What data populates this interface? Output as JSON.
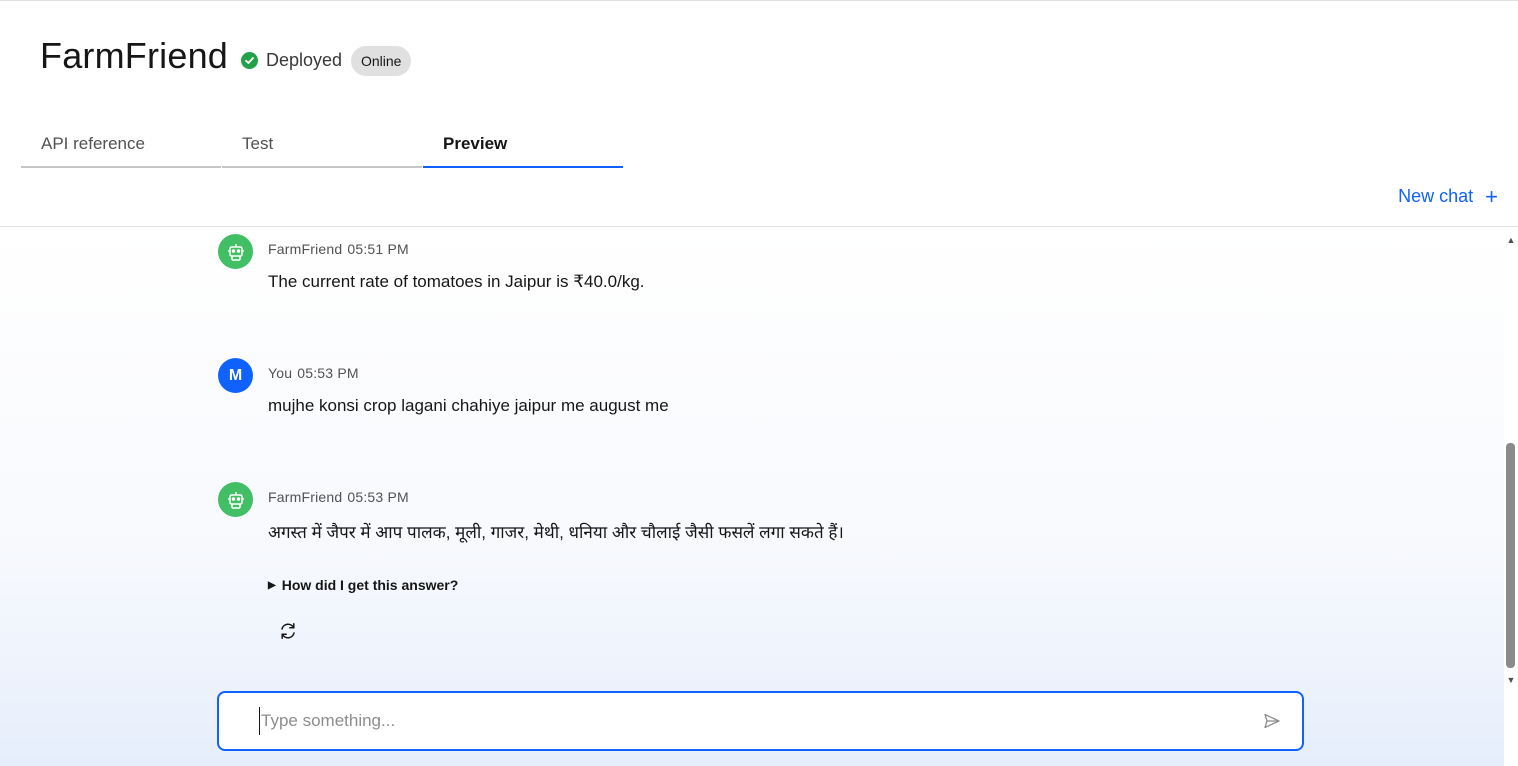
{
  "header": {
    "app_title": "FarmFriend",
    "status_text": "Deployed",
    "badge": "Online",
    "status_color": "#24a148"
  },
  "tabs": [
    {
      "label": "API reference",
      "active": false
    },
    {
      "label": "Test",
      "active": false
    },
    {
      "label": "Preview",
      "active": true
    }
  ],
  "actions": {
    "new_chat": "New chat",
    "new_chat_icon": "plus-icon"
  },
  "messages": [
    {
      "sender": "FarmFriend",
      "time": "05:51 PM",
      "avatar": "robot-icon",
      "text": "The current rate of tomatoes in Jaipur is ₹40.0/kg."
    },
    {
      "sender": "You",
      "time": "05:53 PM",
      "avatar_initial": "M",
      "text": "mujhe konsi crop lagani chahiye jaipur me august me"
    },
    {
      "sender": "FarmFriend",
      "time": "05:53 PM",
      "avatar": "robot-icon",
      "text": "अगस्त में जैपर में आप पालक, मूली, गाजर, मेथी, धनिया और चौलाई जैसी फसलें लगा सकते हैं।",
      "details_label": "How did I get this answer?",
      "regenerate_icon": "regenerate-icon"
    }
  ],
  "input": {
    "placeholder": "Type something...",
    "value": "",
    "send_icon": "send-icon"
  },
  "colors": {
    "accent": "#0f62fe",
    "bot_avatar": "#42be65",
    "user_avatar": "#0f62fe"
  }
}
